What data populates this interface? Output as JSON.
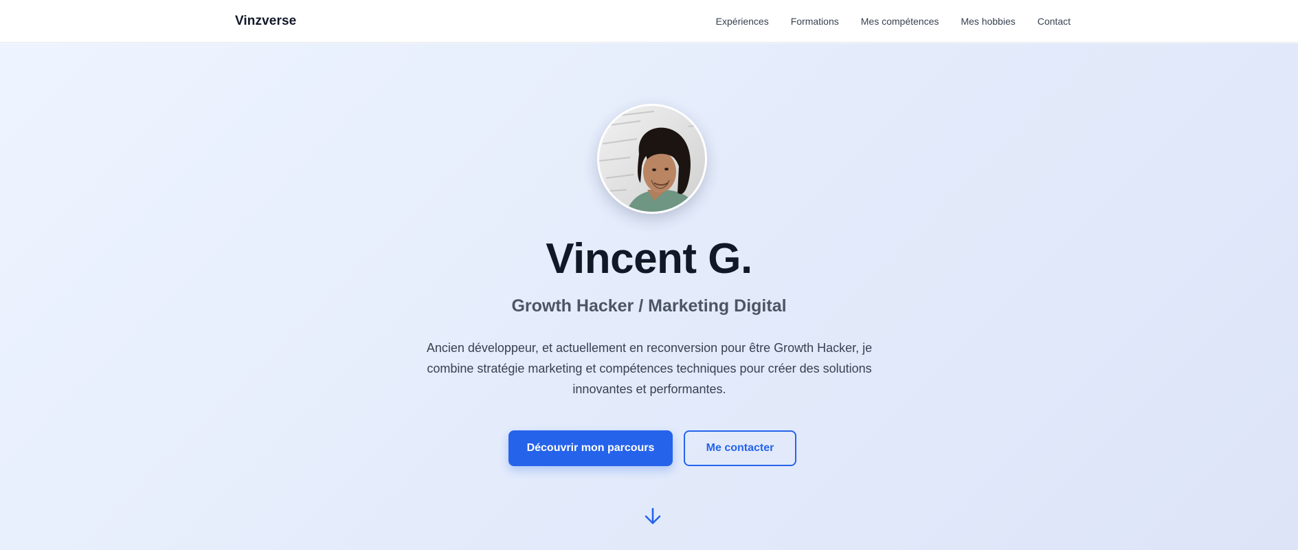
{
  "nav": {
    "brand": "Vinzverse",
    "links": [
      "Expériences",
      "Formations",
      "Mes compétences",
      "Mes hobbies",
      "Contact"
    ]
  },
  "hero": {
    "name": "Vincent G.",
    "subtitle": "Growth Hacker / Marketing Digital",
    "description": "Ancien développeur, et actuellement en reconversion pour être Growth Hacker, je combine stratégie marketing et compétences techniques pour créer des solutions innovantes et performantes.",
    "primary_button": "Découvrir mon parcours",
    "secondary_button": "Me contacter",
    "scroll_icon": "arrow-down-icon"
  },
  "colors": {
    "accent": "#2563eb",
    "heading": "#111827",
    "subtitle": "#4b5563",
    "hero_bg_start": "#eef4ff",
    "hero_bg_end": "#dde4f8"
  }
}
